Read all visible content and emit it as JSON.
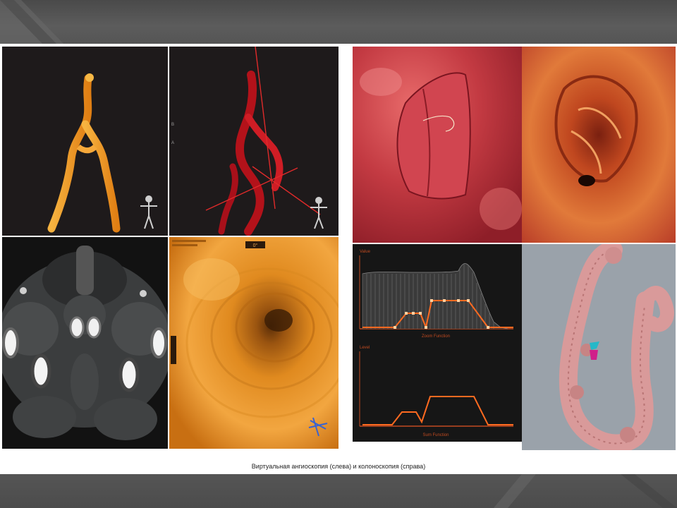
{
  "caption": "Виртуальная ангиоскопия (слева) и колоноскопия (справа)",
  "graphs": {
    "upper_ylabel": "Value",
    "upper_xlabel": "Zoom Function",
    "lower_ylabel": "Level",
    "lower_xlabel": "Sum Function"
  },
  "viewer": {
    "angle_label": "0°"
  },
  "colors": {
    "background": "#ffffff",
    "frame": "#5a5a5a",
    "vessel_orange": "#f29a2a",
    "vessel_red": "#c8141c",
    "endo_orange": "#e08a1f",
    "mucosa_red": "#c8383e",
    "graph_line": "#e0622a",
    "colon_pink": "#d99a9a"
  }
}
